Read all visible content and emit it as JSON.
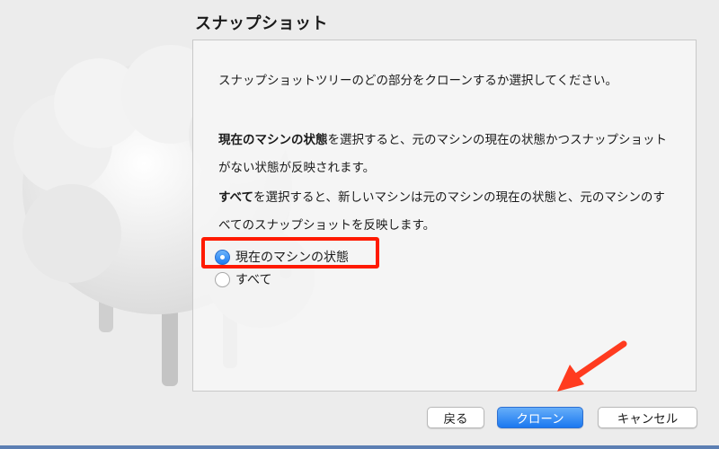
{
  "page": {
    "title": "スナップショット"
  },
  "description": {
    "intro": "スナップショットツリーのどの部分をクローンするか選択してください。",
    "current_state_bold": "現在のマシンの状態",
    "current_state_rest": "を選択すると、元のマシンの現在の状態かつスナップショットがない状態が反映されます。",
    "all_bold": "すべて",
    "all_rest": "を選択すると、新しいマシンは元のマシンの現在の状態と、元のマシンのすべてのスナップショットを反映します。"
  },
  "options": [
    {
      "label": "現在のマシンの状態",
      "selected": true
    },
    {
      "label": "すべて",
      "selected": false
    }
  ],
  "buttons": {
    "back": "戻る",
    "clone": "クローン",
    "cancel": "キャンセル"
  },
  "colors": {
    "accent": "#1d7cf2",
    "highlight": "#ff1a00",
    "arrow": "#ff3b1f"
  }
}
